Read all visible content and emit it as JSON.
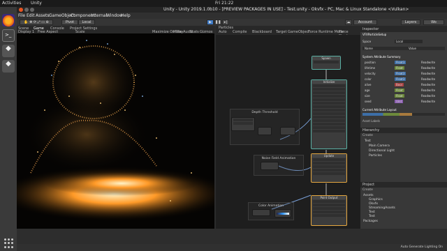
{
  "os": {
    "activities": "Activities",
    "app": "Unity",
    "clock": "Fri 21:22"
  },
  "window": {
    "title": "Unity - Unity 2019.1.0b10 - [PREVIEW PACKAGES IN USE] - Test.unity - Okvfx - PC, Mac & Linux Standalone <Vulkan>"
  },
  "menu": [
    "File",
    "Edit",
    "Assets",
    "GameObject",
    "Component",
    "Internal",
    "Window",
    "Help"
  ],
  "toolbar": {
    "pivot": "Pivot",
    "local": "Local",
    "account": "Account",
    "layers": "Layers",
    "layout": "Wo"
  },
  "game": {
    "tabs": [
      "Scene",
      "Game",
      "Console",
      "Project Settings"
    ],
    "display": "Display 1",
    "aspect": "Free Aspect",
    "scale": "Scale",
    "maximize": "Maximize On Play",
    "mute": "Mute Audio",
    "stats": "Stats",
    "gizmos": "Gizmos"
  },
  "vfx": {
    "tab": "Particles",
    "toolbar": [
      "Auto",
      "Compile",
      "Blackboard",
      "Target GameObject",
      "Force Runtime Mode",
      "Force Shader Validation"
    ],
    "groups": {
      "depth": "Depth Threshold",
      "noise": "Noise Field Animation",
      "color": "Color Animation"
    },
    "nodes": {
      "spawn": "Spawn",
      "init": "Initialize",
      "update": "Update",
      "output": "Point Output"
    }
  },
  "inspector": {
    "tab": "Inspector",
    "asset": "VFXParticleSetup",
    "space_label": "Space",
    "space_val": "Local",
    "name_col": "Name",
    "value_col": "Value",
    "rows": [
      {
        "n": "position",
        "t": "Float3",
        "v": "Readwrite"
      },
      {
        "n": "lifetime",
        "t": "Float",
        "v": "Readwrite"
      },
      {
        "n": "velocity",
        "t": "Float3",
        "v": "Readwrite"
      },
      {
        "n": "color",
        "t": "Float3",
        "v": "Readwrite"
      },
      {
        "n": "alive",
        "t": "Bool",
        "v": "Readwrite"
      },
      {
        "n": "age",
        "t": "Float",
        "v": "Readwrite"
      },
      {
        "n": "size",
        "t": "Float",
        "v": "Readwrite"
      },
      {
        "n": "seed",
        "t": "Uint",
        "v": "Readwrite"
      }
    ],
    "section1": "System Attribute Summary",
    "section2": "Current Attribute Layout",
    "asset_labels": "Asset Labels"
  },
  "hierarchy": {
    "tab": "Hierarchy",
    "create": "Create",
    "items": [
      "Test",
      "Main Camera",
      "Directional Light",
      "Particles"
    ]
  },
  "project": {
    "tab": "Project",
    "create": "Create",
    "items": [
      "Assets",
      "Graphics",
      "Okvfx",
      "StreamingAssets",
      "Test",
      "Test",
      "Packages"
    ]
  },
  "status": {
    "text": "Auto Generate Lighting On"
  }
}
